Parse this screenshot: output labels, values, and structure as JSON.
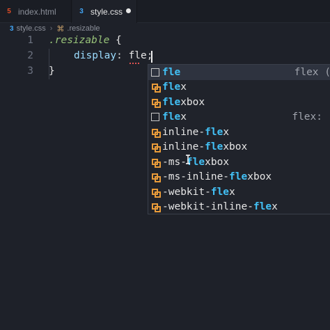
{
  "tabs": [
    {
      "label": "index.html",
      "icon": "html5-icon",
      "active": false
    },
    {
      "label": "style.css",
      "icon": "css3-icon",
      "active": true,
      "unsaved": true
    }
  ],
  "breadcrumb": {
    "file": "style.css",
    "symbol": ".resizable"
  },
  "editor": {
    "line_numbers": [
      "1",
      "2",
      "3"
    ],
    "line1": {
      "selector": ".resizable",
      "brace": "{"
    },
    "line2": {
      "property": "display",
      "colon": ":",
      "value": "fle",
      "semi": ";"
    },
    "line3": {
      "brace": "}"
    }
  },
  "suggestions": [
    {
      "kind": "value",
      "match": "fle",
      "rest": "",
      "detail": "flex (",
      "active": true
    },
    {
      "kind": "snippet",
      "match": "fle",
      "rest": "x",
      "detail": ""
    },
    {
      "kind": "snippet",
      "match": "fle",
      "rest": "xbox",
      "detail": ""
    },
    {
      "kind": "value",
      "match": "fle",
      "rest": "x",
      "detail": "flex:"
    },
    {
      "kind": "snippet",
      "pre": "inline-",
      "match": "fle",
      "rest": "x",
      "detail": ""
    },
    {
      "kind": "snippet",
      "pre": "inline-",
      "match": "fle",
      "rest": "xbox",
      "detail": ""
    },
    {
      "kind": "snippet",
      "pre": "-ms-",
      "match": "fle",
      "rest": "xbox",
      "detail": ""
    },
    {
      "kind": "snippet",
      "pre": "-ms-inline-",
      "match": "fle",
      "rest": "xbox",
      "detail": ""
    },
    {
      "kind": "snippet",
      "pre": "-webkit-",
      "match": "fle",
      "rest": "x",
      "detail": ""
    },
    {
      "kind": "snippet",
      "pre": "-webkit-inline-",
      "match": "fle",
      "rest": "x",
      "detail": ""
    }
  ]
}
